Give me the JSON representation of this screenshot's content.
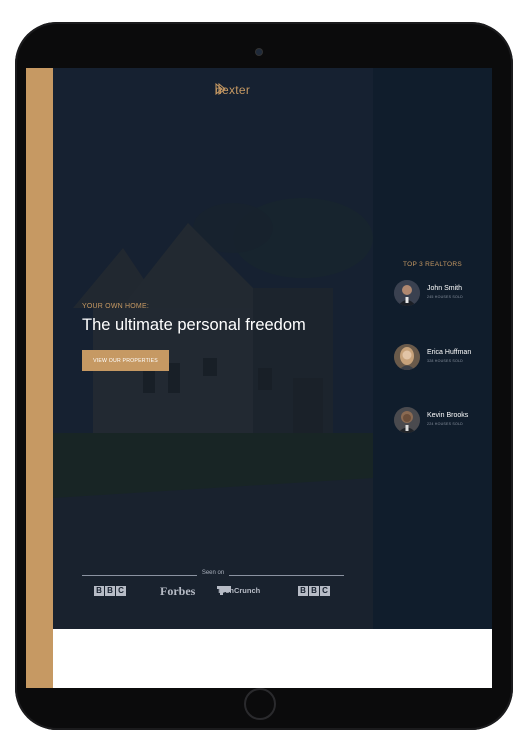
{
  "app": {
    "logo_text": "nexter"
  },
  "hero": {
    "tagline": "YOUR OWN HOME:",
    "headline": "The ultimate personal freedom",
    "cta_label": "VIEW OUR PROPERTIES",
    "seen_on_label": "Seen on",
    "press_logos": [
      "BBC",
      "Forbes",
      "TechCrunch",
      "BBC"
    ]
  },
  "realtors": {
    "title": "TOP 3 REALTORS",
    "items": [
      {
        "name": "John Smith",
        "sold": "245 HOUSES SOLD"
      },
      {
        "name": "Erica Huffman",
        "sold": "328 HOUSES SOLD"
      },
      {
        "name": "Kevin Brooks",
        "sold": "224 HOUSES SOLD"
      }
    ]
  },
  "colors": {
    "accent": "#c69963",
    "hero_bg": "#182233",
    "sidebar_bg": "#101d2c"
  }
}
